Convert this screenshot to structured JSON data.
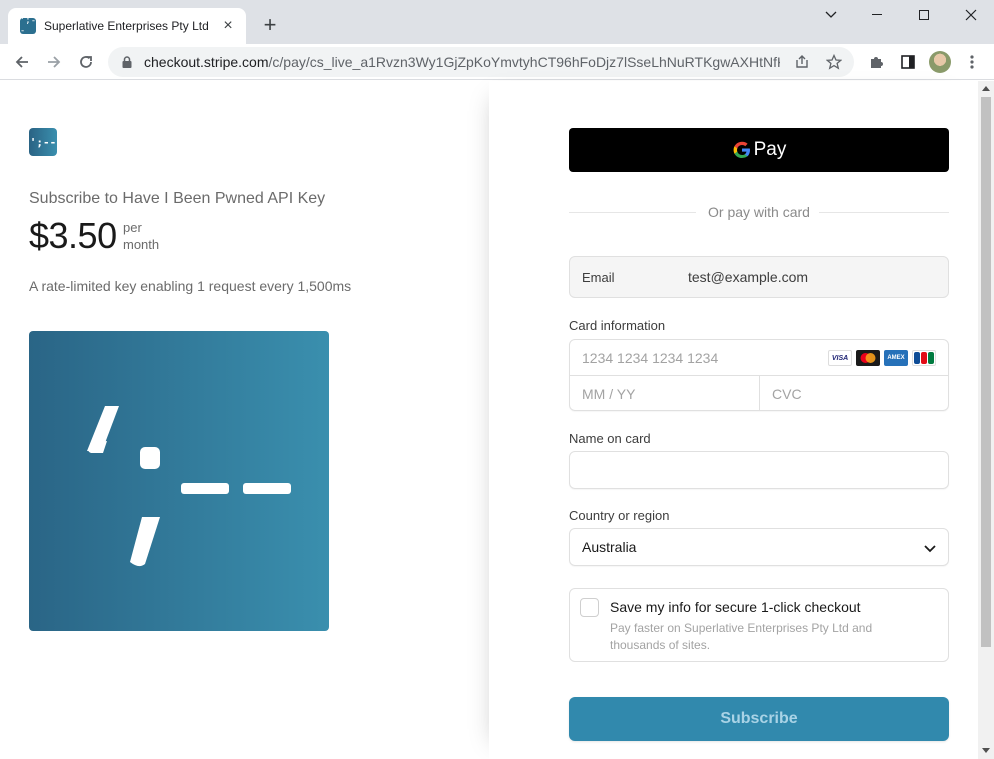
{
  "browser": {
    "tab_title": "Superlative Enterprises Pty Ltd",
    "favicon_text": "';--",
    "url_host": "checkout.stripe.com",
    "url_path": "/c/pay/cs_live_a1Rvzn3Wy1GjZpKoYmvtyhCT96hFoDjz7lSseLhNuRTKgwAXHtNfK4..."
  },
  "product": {
    "logo_text": "';--",
    "name": "Subscribe to Have I Been Pwned API Key",
    "price": "$3.50",
    "interval_line1": "per",
    "interval_line2": "month",
    "description": "A rate-limited key enabling 1 request every 1,500ms"
  },
  "checkout": {
    "gpay_label": "Pay",
    "divider_text": "Or pay with card",
    "email_label": "Email",
    "email_value": "test@example.com",
    "card_info_label": "Card information",
    "card_number_placeholder": "1234 1234 1234 1234",
    "expiry_placeholder": "MM / YY",
    "cvc_placeholder": "CVC",
    "card_brands": [
      "VISA",
      "Mastercard",
      "AMEX",
      "JCB"
    ],
    "name_label": "Name on card",
    "name_value": "",
    "country_label": "Country or region",
    "country_value": "Australia",
    "save_title": "Save my info for secure 1-click checkout",
    "save_subtitle": "Pay faster on Superlative Enterprises Pty Ltd and thousands of sites.",
    "save_checked": false,
    "subscribe_label": "Subscribe"
  },
  "colors": {
    "brand_accent": "#3189ad",
    "image_gradient_start": "#2a6586",
    "image_gradient_end": "#3a8fae"
  }
}
